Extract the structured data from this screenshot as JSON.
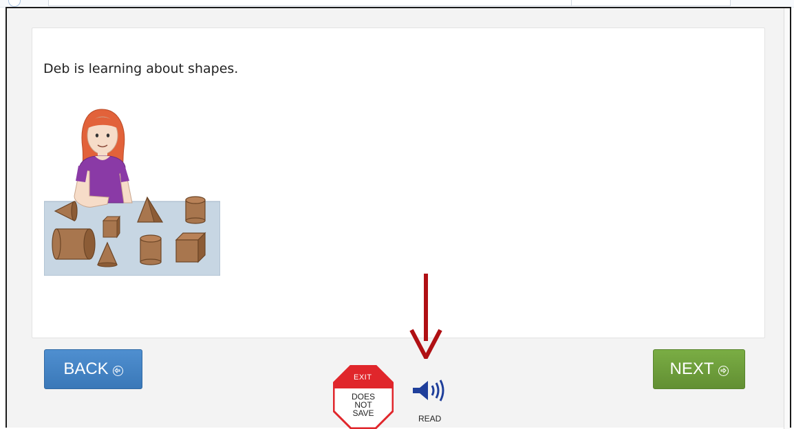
{
  "question": {
    "prompt": "Deb is learning about shapes."
  },
  "nav": {
    "back_label": "BACK",
    "next_label": "NEXT"
  },
  "exit": {
    "top_label": "EXIT",
    "line1": "DOES",
    "line2": "NOT",
    "line3": "SAVE"
  },
  "read": {
    "label": "READ"
  },
  "colors": {
    "back_button": "#3f7fbf",
    "next_button": "#6c9c3a",
    "exit_red": "#e0262b",
    "speaker_blue": "#1f3f9b",
    "annotation_arrow": "#b01014"
  },
  "icons": [
    "back-arrow-circle-icon",
    "next-arrow-circle-icon",
    "speaker-icon",
    "stop-sign-icon"
  ]
}
